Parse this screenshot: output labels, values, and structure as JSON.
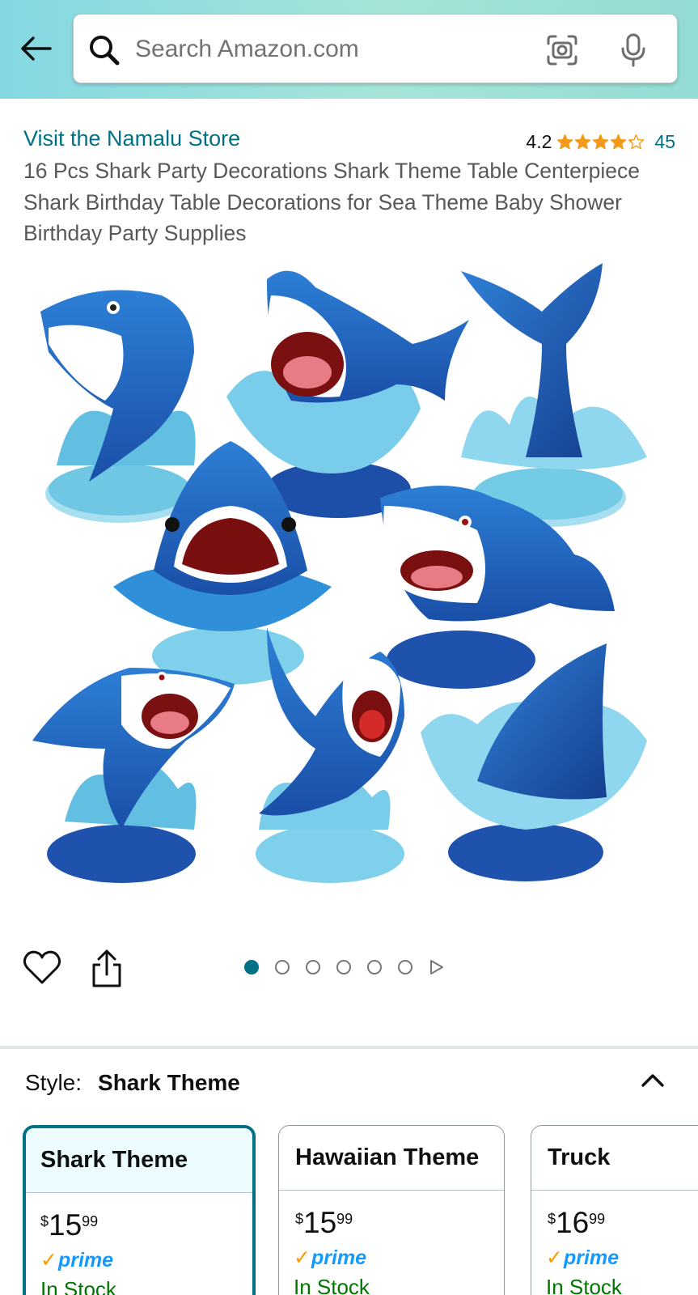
{
  "search": {
    "placeholder": "Search Amazon.com"
  },
  "product": {
    "store_link": "Visit the Namalu Store",
    "rating": "4.2",
    "rating_value": 4.2,
    "review_count": "45",
    "title": "16 Pcs Shark Party Decorations Shark Theme Table Centerpiece Shark Birthday Table Decorations for Sea Theme Baby Shower Birthday Party Supplies"
  },
  "gallery": {
    "image_count": 6,
    "active_index": 0
  },
  "style_selector": {
    "label": "Style:",
    "selected_value": "Shark Theme",
    "options": [
      {
        "name": "Shark Theme",
        "currency": "$",
        "whole": "15",
        "fraction": "99",
        "prime": "prime",
        "stock": "In Stock",
        "selected": true
      },
      {
        "name": "Hawaiian Theme",
        "currency": "$",
        "whole": "15",
        "fraction": "99",
        "prime": "prime",
        "stock": "In Stock",
        "selected": false
      },
      {
        "name": "Truck",
        "currency": "$",
        "whole": "16",
        "fraction": "99",
        "prime": "prime",
        "stock": "In Stock",
        "selected": false
      }
    ]
  },
  "colors": {
    "header_teal": "#84d8e2",
    "link": "#007185",
    "star": "#f49a1a",
    "prime_blue": "#1399ff",
    "stock_green": "#007600"
  },
  "icons": [
    "back-arrow-icon",
    "search-icon",
    "camera-icon",
    "microphone-icon",
    "heart-icon",
    "share-icon",
    "chevron-up-icon",
    "play-icon",
    "star-icon"
  ]
}
